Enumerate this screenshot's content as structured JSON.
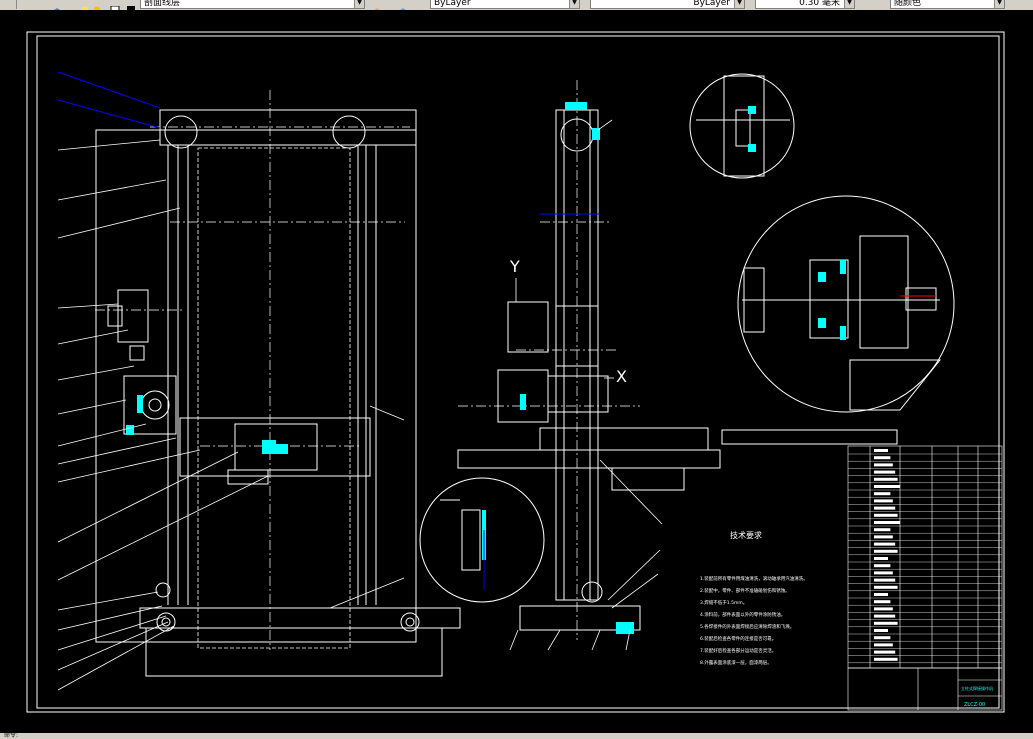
{
  "toolbar": {
    "layer_combo": "剖面线层",
    "color_combo": "ByLayer",
    "linetype_combo": "ByLayer",
    "lineweight_combo": "0.30 毫米",
    "plotstyle_combo": "随颜色"
  },
  "drawing": {
    "axis_y": "Y",
    "axis_x": "X",
    "tech_title": "技术要求",
    "tech_lines": [
      "1.装配前所有零件用煤油清洗，滚动轴承用汽油清洗。",
      "2.装配中，零件、部件不准磕碰划伤和锈蚀。",
      "3.焊缝不低于1.5mm。",
      "4.涂料前，部件表面以外的零件涂防锈油。",
      "5.各焊接件的外表面焊接后应清除焊渣和飞溅。",
      "6.装配后检查各零件的连接是否可靠。",
      "7.装配好后检查各部分运动是否灵活。",
      "8.外露表面涂底漆一层，面漆两层。"
    ],
    "title_block_name": "立柱式焊接操作机",
    "title_block_code": "ZLCZ-00"
  },
  "status": {
    "text": "命令:"
  },
  "colors": {
    "cad_bg": "#000000",
    "line_white": "#ffffff",
    "accent_cyan": "#00ffff",
    "accent_blue": "#0000ff",
    "accent_red": "#ff0000"
  }
}
